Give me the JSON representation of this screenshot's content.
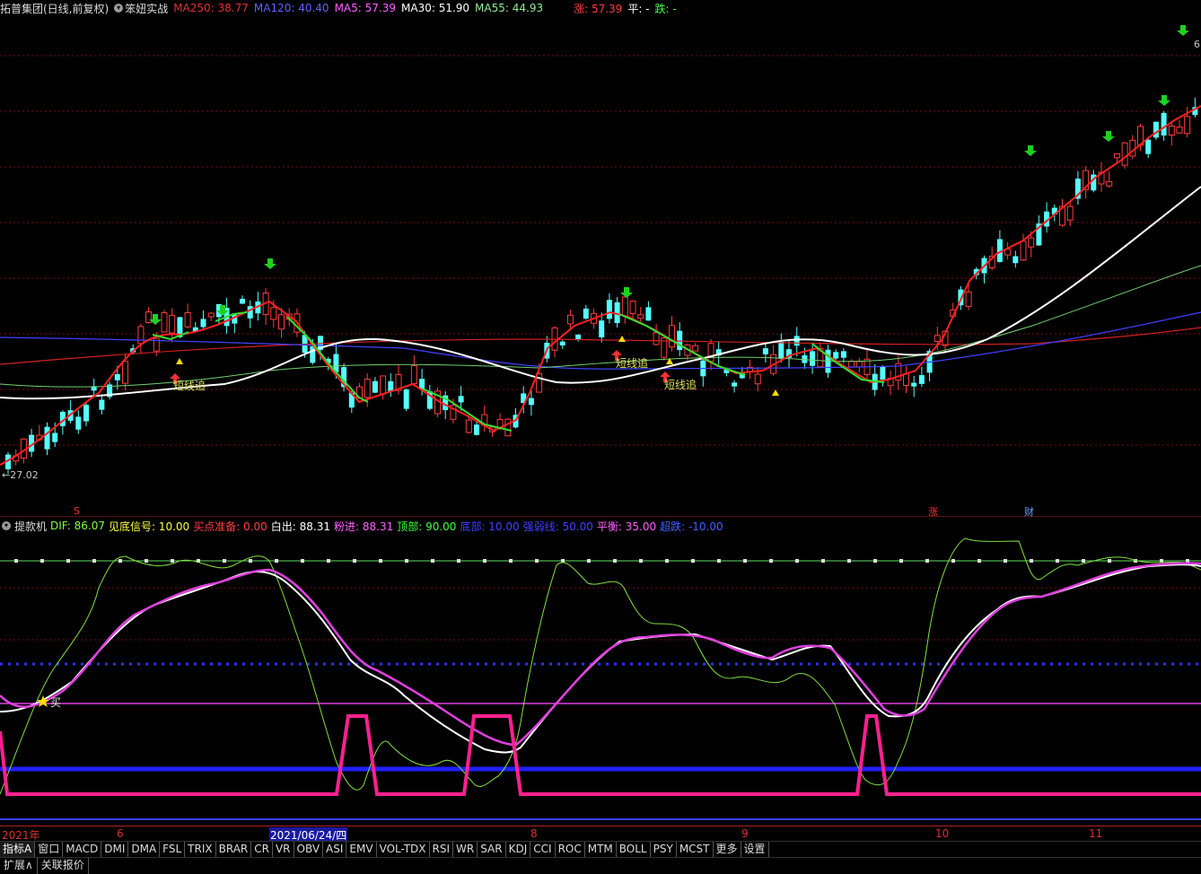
{
  "header": {
    "stock_title": "拓普集团(日线,前复权)",
    "indicator_name": "笨妞实战",
    "ma250": "MA250: 38.77",
    "ma120": "MA120: 40.40",
    "ma5": "MA5: 57.39",
    "ma30": "MA30: 51.90",
    "ma55": "MA55: 44.93",
    "zhang": "涨: 57.39",
    "ping": "平: -",
    "die": "跌: -"
  },
  "price_chart": {
    "low_label": "←27.02",
    "high_label": "6",
    "annotations": {
      "short_chase_1": "短线追",
      "short_chase_2": "短线追",
      "short_chase_3": "短线追"
    },
    "markers": {
      "s_marker": "S",
      "zhang_marker": "涨",
      "cai_marker": "财"
    }
  },
  "indicator": {
    "name": "提款机",
    "dif": "DIF: 86.07",
    "jiandi": "见底信号: 10.00",
    "maidian": "买点准备: 0.00",
    "baichu": "白出: 88.31",
    "fenjin": "粉进: 88.31",
    "dingbu": "顶部: 90.00",
    "dibu": "底部: 10.00",
    "qiangruo": "强弱线: 50.00",
    "pingheng": "平衡: 35.00",
    "chaodie": "超跌: -10.00",
    "buy_label": "买"
  },
  "date_axis": {
    "year": "2021年",
    "m6": "6",
    "cursor_date": "2021/06/24/四",
    "m8": "8",
    "m9": "9",
    "m10": "10",
    "m11": "11"
  },
  "tabs": [
    "指标A",
    "窗口",
    "MACD",
    "DMI",
    "DMA",
    "FSL",
    "TRIX",
    "BRAR",
    "CR",
    "VR",
    "OBV",
    "ASI",
    "EMV",
    "VOL-TDX",
    "RSI",
    "WR",
    "SAR",
    "KDJ",
    "CCI",
    "ROC",
    "MTM",
    "BOLL",
    "PSY",
    "MCST",
    "更多",
    "设置"
  ],
  "bottom_tabs": {
    "expand": "扩展∧",
    "related": "关联报价"
  },
  "colors": {
    "up": "#ff3c3c",
    "down": "#54ffff",
    "ma5": "#ff2020",
    "ma30": "#ffffff",
    "ma55": "#90ee90",
    "ma120": "#4040ff",
    "ma250": "#d02020",
    "pink": "#ff44cc",
    "magenta": "#e040e0",
    "blue": "#2020ff",
    "green": "#80ff40"
  }
}
